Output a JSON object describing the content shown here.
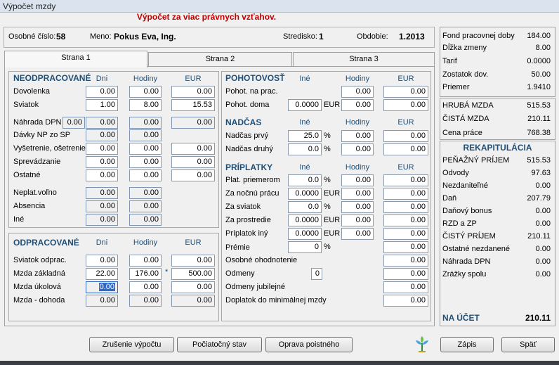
{
  "window": {
    "title": "Výpočet mzdy"
  },
  "heading": "Výpočet za viac právnych vzťahov.",
  "header": {
    "osobne_label": "Osobné číslo:",
    "osobne_value": "58",
    "meno_label": "Meno:",
    "meno_value": "Pokus Eva, Ing.",
    "stredisko_label": "Stredisko:",
    "stredisko_value": "1",
    "obdobie_label": "Obdobie:",
    "obdobie_value": "1.2013"
  },
  "tabs": [
    "Strana 1",
    "Strana 2",
    "Strana 3"
  ],
  "neodpracovane": {
    "title": "NEODPRACOVANÉ",
    "col_dni": "Dni",
    "col_hodiny": "Hodiny",
    "col_eur": "EUR",
    "dovolenka": {
      "label": "Dovolenka",
      "dni": "0.00",
      "hod": "0.00",
      "eur": "0.00"
    },
    "sviatok": {
      "label": "Sviatok",
      "dni": "1.00",
      "hod": "8.00",
      "eur": "15.53"
    },
    "nahrada": {
      "label": "Náhrada DPN",
      "pre": "0.00",
      "dni": "0.00",
      "hod": "0.00",
      "eur": "0.00"
    },
    "davky": {
      "label": "Dávky NP zo SP",
      "dni": "0.00",
      "hod": "0.00"
    },
    "vysetrenie": {
      "label": "Vyšetrenie, ošetrenie",
      "dni": "0.00",
      "hod": "0.00",
      "eur": "0.00"
    },
    "sprevadzanie": {
      "label": "Sprevádzanie",
      "dni": "0.00",
      "hod": "0.00",
      "eur": "0.00"
    },
    "ostatne": {
      "label": "Ostatné",
      "dni": "0.00",
      "hod": "0.00",
      "eur": "0.00"
    },
    "neplat": {
      "label": "Neplat.voľno",
      "dni": "0.00",
      "hod": "0.00"
    },
    "absencia": {
      "label": "Absencia",
      "dni": "0.00",
      "hod": "0.00"
    },
    "ine": {
      "label": "Iné",
      "dni": "0.00",
      "hod": "0.00"
    }
  },
  "odpracovane": {
    "title": "ODPRACOVANÉ",
    "col_dni": "Dni",
    "col_hodiny": "Hodiny",
    "col_eur": "EUR",
    "sviatok": {
      "label": "Sviatok odprac.",
      "dni": "0.00",
      "hod": "0.00",
      "eur": "0.00"
    },
    "zakladna": {
      "label": "Mzda základná",
      "dni": "22.00",
      "hod": "176.00",
      "star": "*",
      "eur": "500.00"
    },
    "ukolova": {
      "label": "Mzda úkolová",
      "dni": "0.00",
      "hod": "0.00",
      "eur": "0.00"
    },
    "dohoda": {
      "label": "Mzda - dohoda",
      "dni": "0.00",
      "hod": "0.00",
      "eur": "0.00"
    }
  },
  "pohotovost": {
    "title": "POHOTOVOSŤ",
    "col_ine": "Iné",
    "col_hodiny": "Hodiny",
    "col_eur": "EUR",
    "naprac": {
      "label": "Pohot. na prac.",
      "hod": "0.00",
      "eur": "0.00"
    },
    "doma": {
      "label": "Pohot. doma",
      "ine": "0.0000",
      "unit": "EUR",
      "hod": "0.00",
      "eur": "0.00"
    }
  },
  "nadcas": {
    "title": "NADČAS",
    "col_ine": "Iné",
    "col_hodiny": "Hodiny",
    "col_eur": "EUR",
    "prvy": {
      "label": "Nadčas prvý",
      "ine": "25.0",
      "unit": "%",
      "hod": "0.00",
      "eur": "0.00"
    },
    "druhy": {
      "label": "Nadčas druhý",
      "ine": "0.0",
      "unit": "%",
      "hod": "0.00",
      "eur": "0.00"
    }
  },
  "priplatky": {
    "title": "PRÍPLATKY",
    "col_ine": "Iné",
    "col_hodiny": "Hodiny",
    "col_eur": "EUR",
    "rows": [
      {
        "label": "Plat. priemerom",
        "ine": "0.0",
        "unit": "%",
        "hod": "0.00",
        "eur": "0.00"
      },
      {
        "label": "Za nočnú prácu",
        "ine": "0.0000",
        "unit": "EUR",
        "hod": "0.00",
        "eur": "0.00"
      },
      {
        "label": "Za sviatok",
        "ine": "0.0",
        "unit": "%",
        "hod": "0.00",
        "eur": "0.00"
      },
      {
        "label": "Za prostredie",
        "ine": "0.0000",
        "unit": "EUR",
        "hod": "0.00",
        "eur": "0.00"
      },
      {
        "label": "Príplatok iný",
        "ine": "0.0000",
        "unit": "EUR",
        "hod": "0.00",
        "eur": "0.00"
      },
      {
        "label": "Prémie",
        "ine": "0",
        "unit": "%",
        "eur": "0.00"
      }
    ],
    "osobne": {
      "label": "Osobné ohodnotenie",
      "eur": "0.00"
    },
    "odmeny": {
      "label": "Odmeny",
      "ine": "0",
      "eur": "0.00"
    },
    "jubilejne": {
      "label": "Odmeny jubilejné",
      "eur": "0.00"
    },
    "doplatok": {
      "label": "Doplatok do minimálnej mzdy",
      "eur": "0.00"
    }
  },
  "right_top": [
    {
      "label": "Fond pracovnej doby",
      "value": "184.00"
    },
    {
      "label": "Dĺžka zmeny",
      "value": "8.00"
    },
    {
      "label": "Tarif",
      "value": "0.0000"
    },
    {
      "label": "Zostatok dov.",
      "value": "50.00"
    },
    {
      "label": "Priemer",
      "value": "1.9410"
    }
  ],
  "right_mid": [
    {
      "label": "HRUBÁ MZDA",
      "value": "515.53"
    },
    {
      "label": "ČISTÁ MZDA",
      "value": "210.11"
    },
    {
      "label": "Cena práce",
      "value": "768.38"
    }
  ],
  "rekap": {
    "title": "REKAPITULÁCIA",
    "rows": [
      {
        "label": "PEŇAŽNÝ PRÍJEM",
        "value": "515.53"
      },
      {
        "label": "Odvody",
        "value": "97.63"
      },
      {
        "label": "Nezdaniteľné",
        "value": "0.00"
      },
      {
        "label": "Daň",
        "value": "207.79"
      },
      {
        "label": "Daňový bonus",
        "value": "0.00"
      },
      {
        "label": "RZD a ZP",
        "value": "0.00"
      },
      {
        "label": "ČISTÝ PRÍJEM",
        "value": "210.11"
      },
      {
        "label": "Ostatné nezdanené",
        "value": "0.00"
      },
      {
        "label": "Náhrada DPN",
        "value": "0.00"
      },
      {
        "label": "Zrážky spolu",
        "value": "0.00"
      }
    ],
    "na_ucet_label": "NA ÚČET",
    "na_ucet_value": "210.11"
  },
  "buttons": {
    "zrusenie": "Zrušenie výpočtu",
    "pociatocny": "Počiatočný stav",
    "oprava": "Oprava poistného",
    "zapis": "Zápis",
    "spat": "Späť"
  },
  "icon": "plant-icon"
}
